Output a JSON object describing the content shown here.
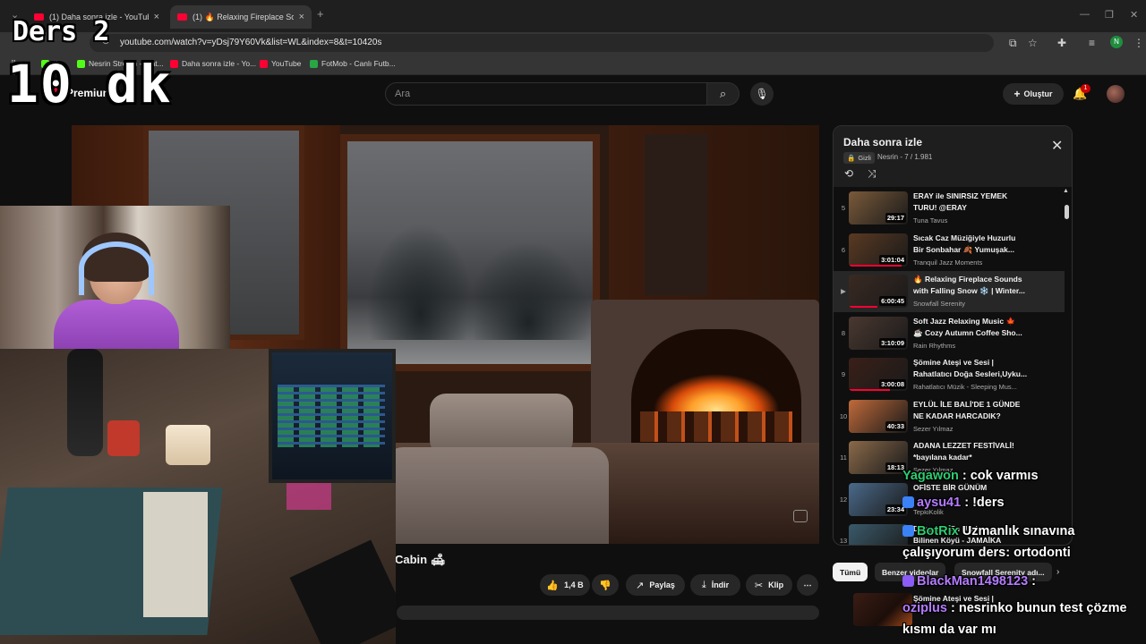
{
  "browser": {
    "tabs": [
      {
        "label": "(1) Daha sonra izle - YouTube",
        "close": "×"
      },
      {
        "label": "(1) 🔥 Relaxing Fireplace Sound",
        "close": "×"
      }
    ],
    "new_tab": "+",
    "url": "youtube.com/watch?v=yDsj79Y60Vk&list=WL&index=8&t=10420s",
    "profile_initial": "N",
    "bookmarks": [
      {
        "label": "Ki",
        "color": "#53fc18"
      },
      {
        "label": "Nesrin Stream - Wat...",
        "color": "#53fc18"
      },
      {
        "label": "Daha sonra izle - Yo...",
        "color": "#ff0033"
      },
      {
        "label": "YouTube",
        "color": "#ff0033"
      },
      {
        "label": "FotMob - Canlı Futb...",
        "color": "#28a745"
      }
    ]
  },
  "overlay": {
    "lesson": "Ders 2",
    "timer": "10 dk"
  },
  "youtube": {
    "brand": "Premium",
    "region": "TR",
    "search_placeholder": "Ara",
    "create_label": "Oluştur",
    "notification_count": "1"
  },
  "video": {
    "title": "Cabin 🛋",
    "actions": {
      "likes": "1,4 B",
      "share": "Paylaş",
      "download": "İndir",
      "clip": "Klip",
      "more": "⋯"
    }
  },
  "playlist": {
    "title": "Daha sonra izle",
    "privacy": "Gizli",
    "owner_progress": "Nesrin - 7 / 1.981",
    "items": [
      {
        "index": "5",
        "title1": "ERAY ile SINIRSIZ YEMEK",
        "title2": "TURU! @ERAY",
        "channel": "Tuna Tavus",
        "duration": "29:17",
        "progress": 0
      },
      {
        "index": "6",
        "title1": "Sıcak Caz Müziğiyle Huzurlu",
        "title2": "Bir Sonbahar 🍂 Yumuşak...",
        "channel": "Tranquil Jazz Moments",
        "duration": "3:01:04",
        "progress": 0.9
      },
      {
        "index": "▶",
        "title1": "🔥 Relaxing Fireplace Sounds",
        "title2": "with Falling Snow ❄️ | Winter...",
        "channel": "Snowfall Serenity",
        "duration": "6:00:45",
        "progress": 0.48
      },
      {
        "index": "8",
        "title1": "Soft Jazz Relaxing Music 🍁",
        "title2": "☕ Cozy Autumn Coffee Sho...",
        "channel": "Rain Rhythms",
        "duration": "3:10:09",
        "progress": 0
      },
      {
        "index": "9",
        "title1": "Şömine Ateşi ve Sesi |",
        "title2": "Rahatlatıcı Doğa Sesleri,Uyku...",
        "channel": "Rahatlatıcı Müzik - Sleeping Mus...",
        "duration": "3:00:08",
        "progress": 0.7
      },
      {
        "index": "10",
        "title1": "EYLÜL İLE BALİ'DE 1 GÜNDE",
        "title2": "NE KADAR HARCADIK?",
        "channel": "Sezer Yılmaz",
        "duration": "40:33",
        "progress": 0
      },
      {
        "index": "11",
        "title1": "ADANA LEZZET FESTİVALİ!",
        "title2": "*bayılana kadar*",
        "channel": "Sezer Yılmaz",
        "duration": "18:13",
        "progress": 0
      },
      {
        "index": "12",
        "title1": "OFİSTE BİR GÜNÜM",
        "title2": "",
        "channel": "TepkiKolik",
        "duration": "23:34",
        "progress": 0
      },
      {
        "index": "13",
        "title1": "Dünyanın En Uzak",
        "title2": "Bilinen Köyü - JAMAİKA",
        "channel": "",
        "duration": "",
        "progress": 0
      }
    ],
    "thumb_colors": [
      "#7a5a3a",
      "#5a3a22",
      "#3a2a22",
      "#4a3830",
      "#3a2018",
      "#c06a3a",
      "#8a6a4a",
      "#4a6a8a",
      "#3a5a6a"
    ]
  },
  "chips": {
    "all": "Tümü",
    "related": "Benzer videolar",
    "channel": "Snowfall Serenity adı...",
    "next": "›"
  },
  "recommendation": {
    "title": "Şömine Ateşi ve Sesi |"
  },
  "chat": [
    {
      "user": "Yagawon",
      "user_color": "#2ecc71",
      "text": " : cok varmıs",
      "badge_color": ""
    },
    {
      "user": "aysu41",
      "user_color": "#b57cff",
      "text": " : !ders",
      "badge_color": "#3b82f6"
    },
    {
      "user": "BotRix",
      "user_color": "#2ecc71",
      "text": " Uzmanlık sınavına çalışıyorum ders: ortodonti",
      "badge_color": "#3b82f6"
    },
    {
      "user": "BlackMan1498123",
      "user_color": "#b57cff",
      "text": " :",
      "badge_color": "#8b5cf6"
    },
    {
      "user": "oziplus",
      "user_color": "#b57cff",
      "text": " : nesrinko bunun test çözme kısmı da var mı",
      "badge_color": ""
    }
  ]
}
